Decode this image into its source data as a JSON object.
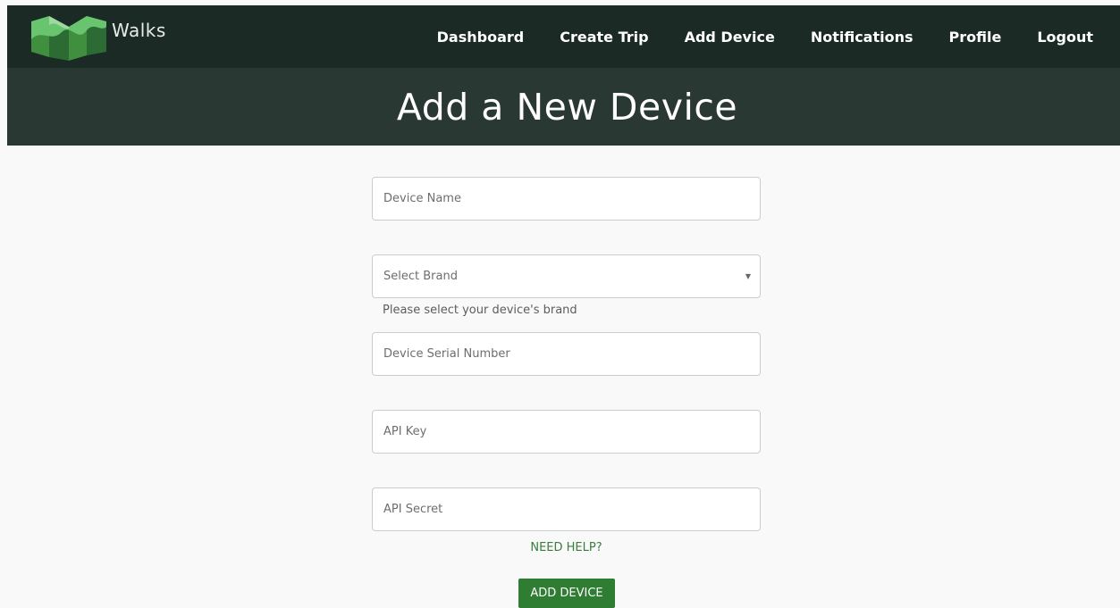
{
  "brand": {
    "name": "Walks",
    "logo_icon": "walks-logo-icon",
    "colors": [
      "#3f8f3f",
      "#68c46e",
      "#9fd9a2",
      "#2d6b34"
    ]
  },
  "nav": {
    "items": [
      {
        "label": "Dashboard"
      },
      {
        "label": "Create Trip"
      },
      {
        "label": "Add Device"
      },
      {
        "label": "Notifications"
      },
      {
        "label": "Profile"
      },
      {
        "label": "Logout"
      }
    ]
  },
  "hero": {
    "title": "Add a New Device"
  },
  "form": {
    "device_name": {
      "placeholder": "Device Name",
      "value": ""
    },
    "brand_select": {
      "selected": "Select Brand",
      "icon": "chevron-down-icon",
      "helper": "Please select your device's brand"
    },
    "serial_number": {
      "placeholder": "Device Serial Number",
      "value": ""
    },
    "api_key": {
      "placeholder": "API Key",
      "value": ""
    },
    "api_secret": {
      "placeholder": "API Secret",
      "value": ""
    },
    "help_link": "NEED HELP?",
    "submit_label": "ADD DEVICE"
  },
  "colors": {
    "navbar": "#1b2a25",
    "hero": "#2a3833",
    "accent": "#2e7d32",
    "link": "#3a7d3f"
  }
}
